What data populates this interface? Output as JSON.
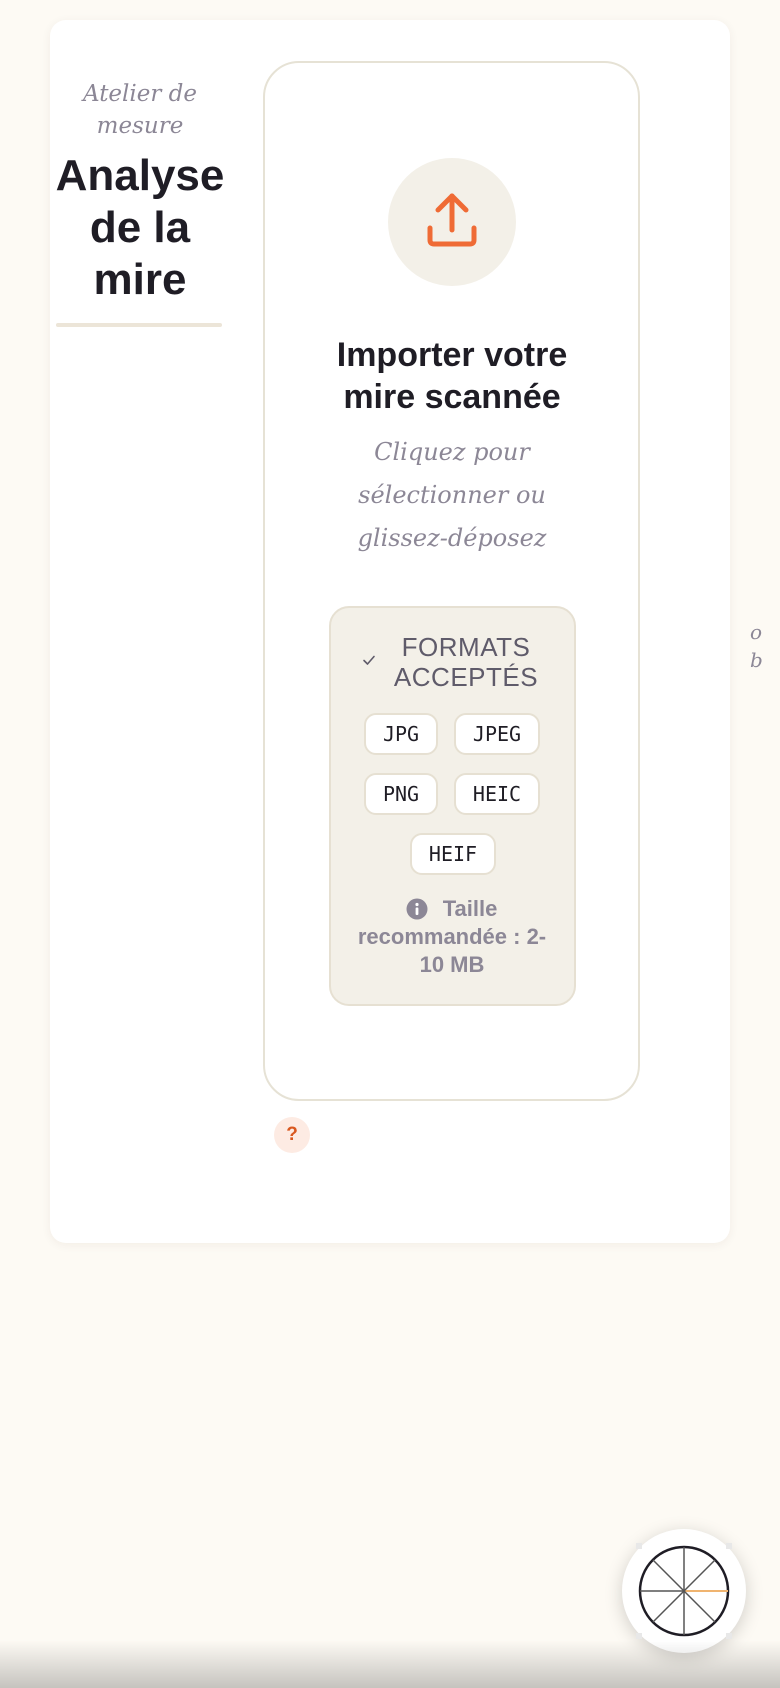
{
  "header": {
    "kicker": "Atelier de mesure",
    "title": "Analyse de la mire"
  },
  "upload": {
    "icon": "upload-icon",
    "heading": "Importer votre mire scannée",
    "hint": "Cliquez pour sélectionner ou glissez-déposez"
  },
  "formats": {
    "heading": "FORMATS ACCEPTÉS",
    "items": [
      "JPG",
      "JPEG",
      "PNG",
      "HEIC",
      "HEIF"
    ],
    "size_note": "Taille recommandée : 2-10 MB"
  },
  "help": {
    "label": "?"
  },
  "side_peek": "o\nb",
  "fab": {
    "icon": "test-chart-wheel-icon"
  },
  "colors": {
    "accent": "#ef6b35",
    "background": "#fdfaf4",
    "card": "#ffffff",
    "muted_text": "#8c8796",
    "dark_text": "#1f1d25",
    "panel": "#f3f0e8"
  }
}
